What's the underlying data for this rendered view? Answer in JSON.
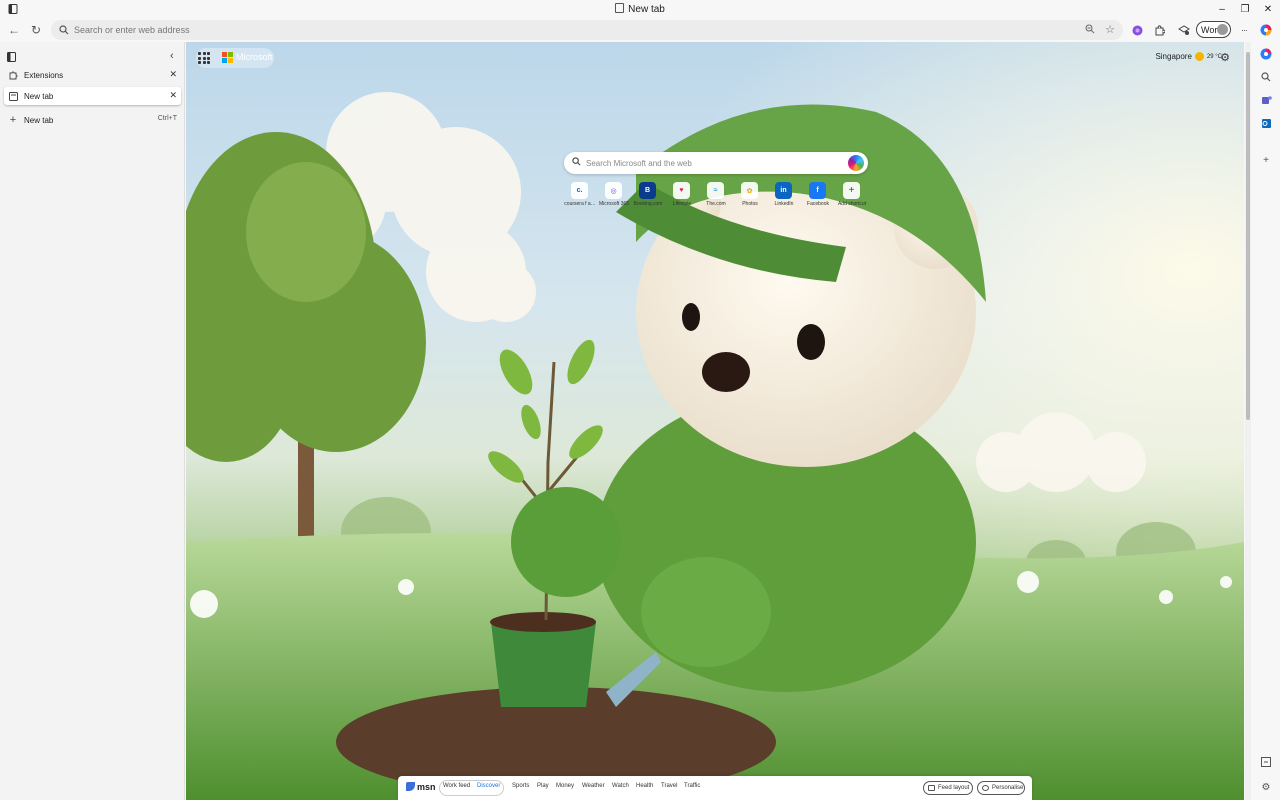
{
  "window": {
    "title": "New tab",
    "controls": {
      "minimize": "–",
      "restore": "❐",
      "close": "✕"
    }
  },
  "toolbar": {
    "back_icon": "←",
    "refresh_icon": "↻",
    "address_placeholder": "Search or enter web address",
    "profile_label": "Work",
    "more_icon": "···"
  },
  "vertical_tabs": {
    "items": [
      {
        "label": "Extensions",
        "icon": "puzzle-icon",
        "active": false
      },
      {
        "label": "New tab",
        "icon": "page-icon",
        "active": true
      }
    ],
    "new_tab": {
      "label": "New tab",
      "shortcut": "Ctrl+T"
    }
  },
  "content": {
    "brand_label": "Microsoft",
    "weather": {
      "city": "Singapore",
      "temp": "29 °C"
    },
    "search_placeholder": "Search Microsoft and the web",
    "quicklinks": [
      {
        "label": "coursera f a…",
        "glyph": "c.",
        "color": "#1a5ec7"
      },
      {
        "label": "Microsoft 365",
        "glyph": "◎",
        "color": "#6b4fd8"
      },
      {
        "label": "Booking.com",
        "glyph": "B",
        "color": "#0b3b8c"
      },
      {
        "label": "Lifestyle",
        "glyph": "♥",
        "color": "#e0245e"
      },
      {
        "label": "The.com",
        "glyph": "≈",
        "color": "#2b9bd8"
      },
      {
        "label": "Photos",
        "glyph": "✿",
        "color": "#e8a100"
      },
      {
        "label": "LinkedIn",
        "glyph": "in",
        "color": "#0a66c2"
      },
      {
        "label": "Facebook",
        "glyph": "f",
        "color": "#1877f2"
      },
      {
        "label": "Add shortcut",
        "glyph": "+",
        "color": "#444444"
      }
    ],
    "bottom_bar": {
      "brand": "msn",
      "tabs": [
        "Work feed",
        "Discover",
        "Sports",
        "Play",
        "Money",
        "Weather",
        "Watch",
        "Health",
        "Travel",
        "Traffic"
      ],
      "selected_tab": "Discover",
      "feed_layout_label": "Feed layout",
      "personalise_label": "Personalise"
    }
  },
  "colors": {
    "accent": "#1a73e8",
    "ms_red": "#f25022",
    "ms_green": "#7fba00",
    "ms_blue": "#00a4ef",
    "ms_yellow": "#ffb900"
  }
}
